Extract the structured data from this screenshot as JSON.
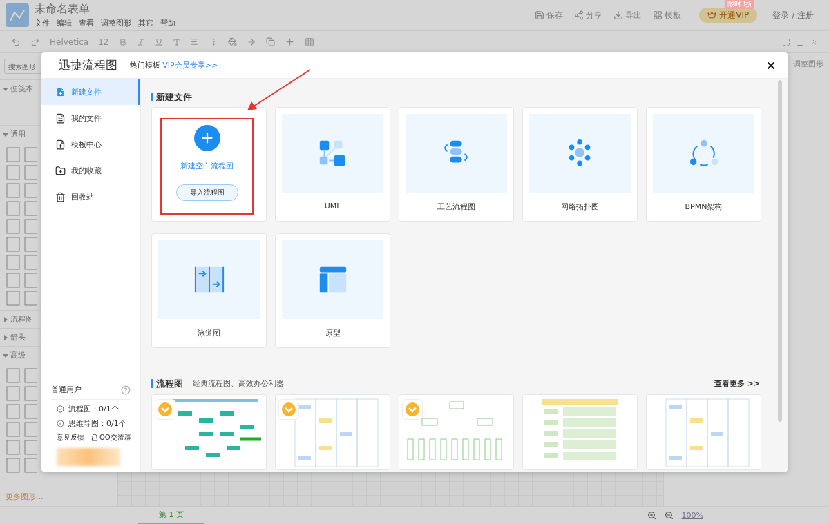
{
  "app": {
    "title": "未命名表单",
    "menu": [
      "文件",
      "编辑",
      "查看",
      "调整图形",
      "其它",
      "帮助"
    ],
    "actions": [
      "保存",
      "分享",
      "导出",
      "模板"
    ],
    "vip": {
      "label": "开通VIP",
      "badge": "限时3折"
    },
    "login": "登录 / 注册"
  },
  "toolbar": {
    "font": "Helvetica",
    "size": "12"
  },
  "shape_panel": {
    "search_placeholder": "搜索图形",
    "sections": [
      {
        "label": "便笺本",
        "expanded": true
      },
      {
        "label": "通用",
        "expanded": true
      },
      {
        "label": "流程图",
        "expanded": false
      },
      {
        "label": "箭头",
        "expanded": false
      },
      {
        "label": "高级",
        "expanded": true
      }
    ],
    "more": "更多图形..."
  },
  "format_panel": {
    "title": "调整图形"
  },
  "page_bar": {
    "page_tab": "第 1 页",
    "zoom": "100%"
  },
  "dialog": {
    "title": "迅捷流程图",
    "hot_label": "热门模板",
    "vip_link": "-VIP会员专享>>",
    "nav": [
      {
        "label": "新建文件",
        "selected": true
      },
      {
        "label": "我的文件",
        "selected": false
      },
      {
        "label": "模板中心",
        "selected": false
      },
      {
        "label": "我的收藏",
        "selected": false
      },
      {
        "label": "回收站",
        "selected": false
      }
    ],
    "user": {
      "plan": "普通用户",
      "quotas": [
        "流程图：0/1个",
        "思维导图：0/1个"
      ],
      "feedback": "意见反馈",
      "group": "QQ交流群"
    },
    "new_section": {
      "title": "新建文件",
      "blank": {
        "label": "新建空白流程图",
        "import_button": "导入流程图"
      },
      "templates": [
        {
          "label": "UML",
          "kind": "uml"
        },
        {
          "label": "工艺流程图",
          "kind": "process"
        },
        {
          "label": "网络拓扑图",
          "kind": "network"
        },
        {
          "label": "BPMN架构",
          "kind": "bpmn"
        },
        {
          "label": "泳道图",
          "kind": "swimlane"
        },
        {
          "label": "原型",
          "kind": "prototype"
        }
      ]
    },
    "flow_section": {
      "title": "流程图",
      "subtitle": "经典流程图、高效办公利器",
      "more": "查看更多 >>",
      "thumbnails": [
        {
          "kind": "flow",
          "vip": true
        },
        {
          "kind": "lanes",
          "vip": true
        },
        {
          "kind": "org",
          "vip": true
        },
        {
          "kind": "steps",
          "vip": false
        },
        {
          "kind": "lanes",
          "vip": false
        }
      ]
    }
  }
}
